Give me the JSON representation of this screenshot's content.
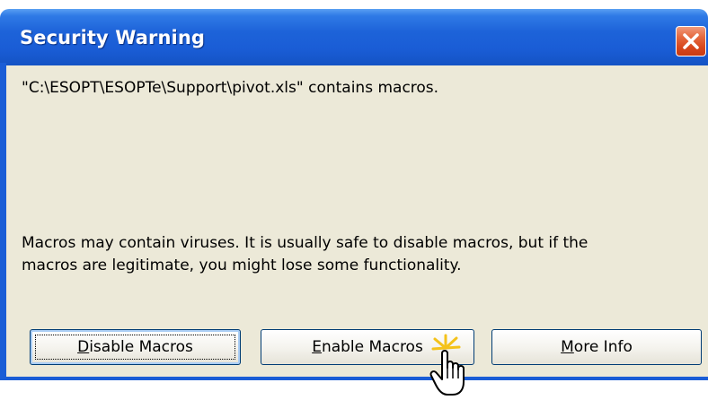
{
  "window": {
    "title": "Security Warning",
    "close_icon": "close-icon"
  },
  "message": {
    "file_line": "\"C:\\ESOPT\\ESOPTe\\Support\\pivot.xls\" contains macros.",
    "warning_line1": "Macros may contain viruses. It is usually safe to disable macros, but if the",
    "warning_line2": "macros are legitimate, you might lose some functionality."
  },
  "buttons": {
    "disable": {
      "accel": "D",
      "rest": "isable Macros"
    },
    "enable": {
      "accel": "E",
      "rest": "nable Macros"
    },
    "more": {
      "accel": "M",
      "rest": "ore Info"
    }
  },
  "colors": {
    "titlebar": "#1a5dd6",
    "client": "#ece9d8",
    "close": "#d8481e"
  },
  "cursor": {
    "icon": "hand-pointer-icon"
  }
}
